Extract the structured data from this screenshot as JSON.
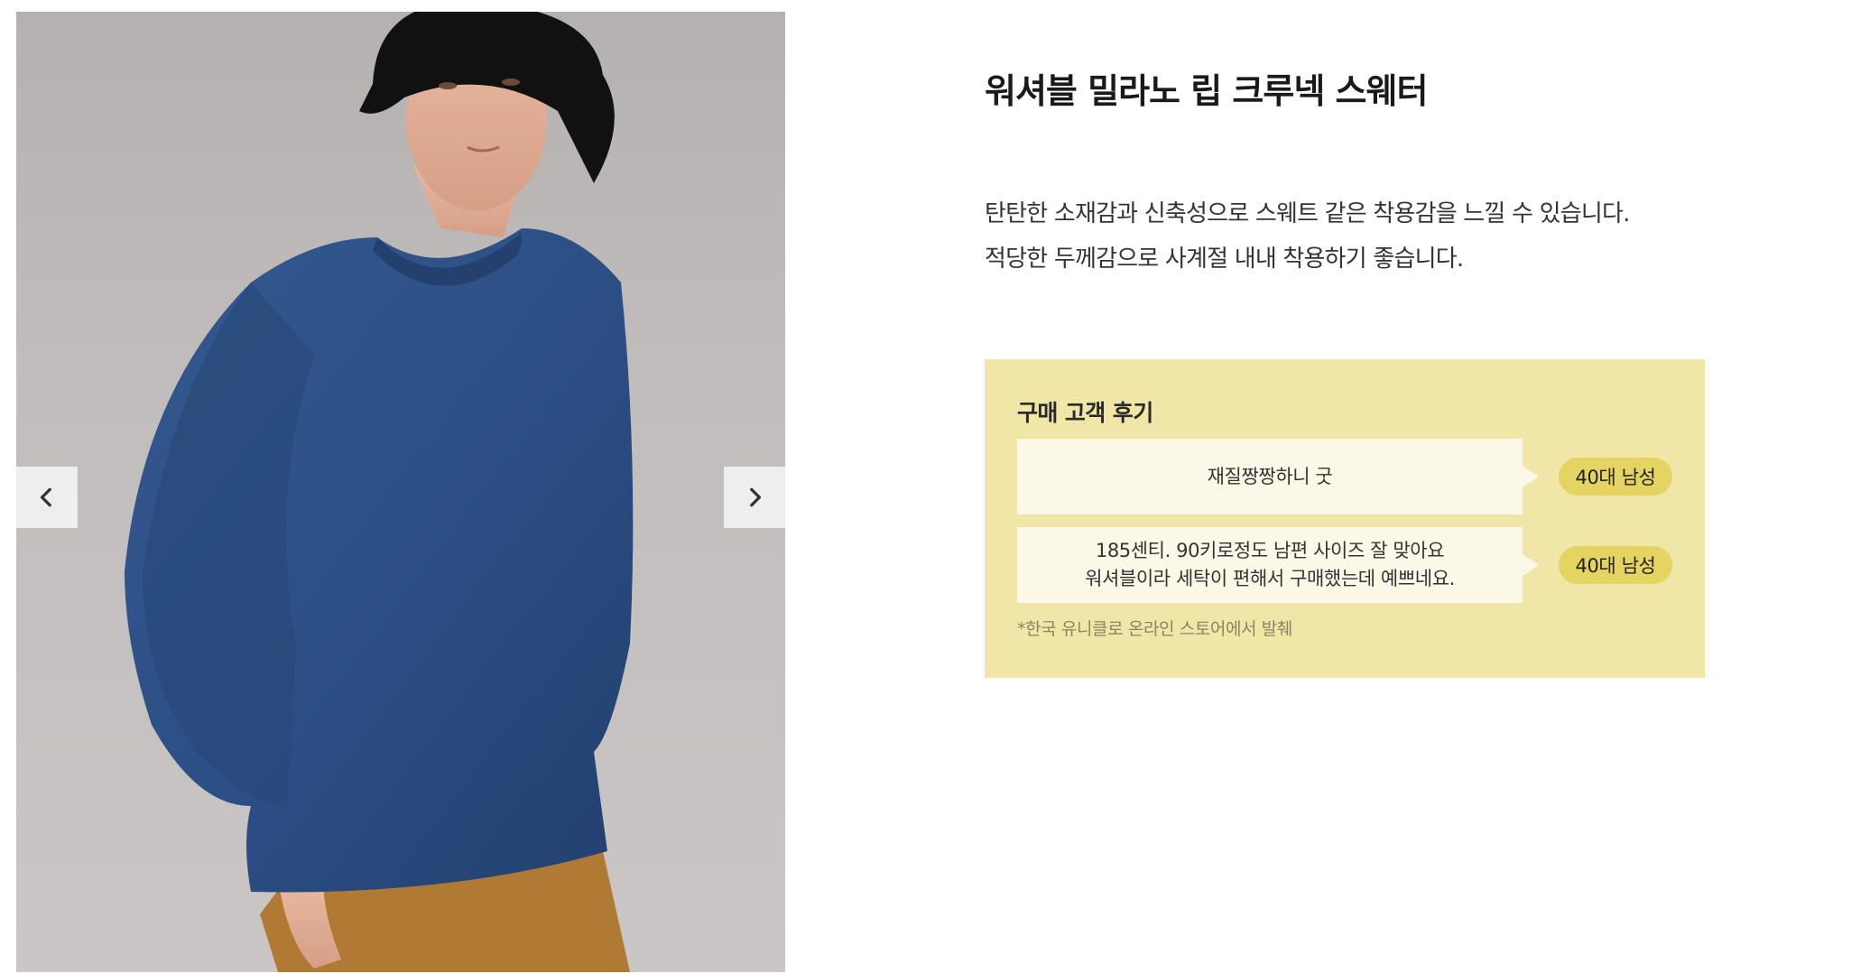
{
  "product": {
    "title": "워셔블 밀라노 립 크루넥 스웨터",
    "description": [
      "탄탄한 소재감과 신축성으로 스웨트 같은 착용감을 느낄 수 있습니다.",
      "적당한 두께감으로 사계절 내내 착용하기 좋습니다."
    ]
  },
  "carousel": {
    "prev_icon": "chevron-left-icon",
    "next_icon": "chevron-right-icon"
  },
  "reviews": {
    "heading": "구매 고객 후기",
    "items": [
      {
        "lines": [
          "재질짱짱하니 굿"
        ],
        "badge": "40대 남성"
      },
      {
        "lines": [
          "185센티. 90키로정도 남편 사이즈 잘 맞아요",
          "워셔블이라 세탁이 편해서 구매했는데 예쁘네요."
        ],
        "badge": "40대 남성"
      }
    ],
    "source_note": "*한국 유니클로 온라인 스토어에서 발췌"
  },
  "colors": {
    "review_background": "#efe6a8",
    "bubble_background": "#fbf8e8",
    "badge_background": "#e6d462",
    "sweater_blue": "#2c4f86"
  }
}
